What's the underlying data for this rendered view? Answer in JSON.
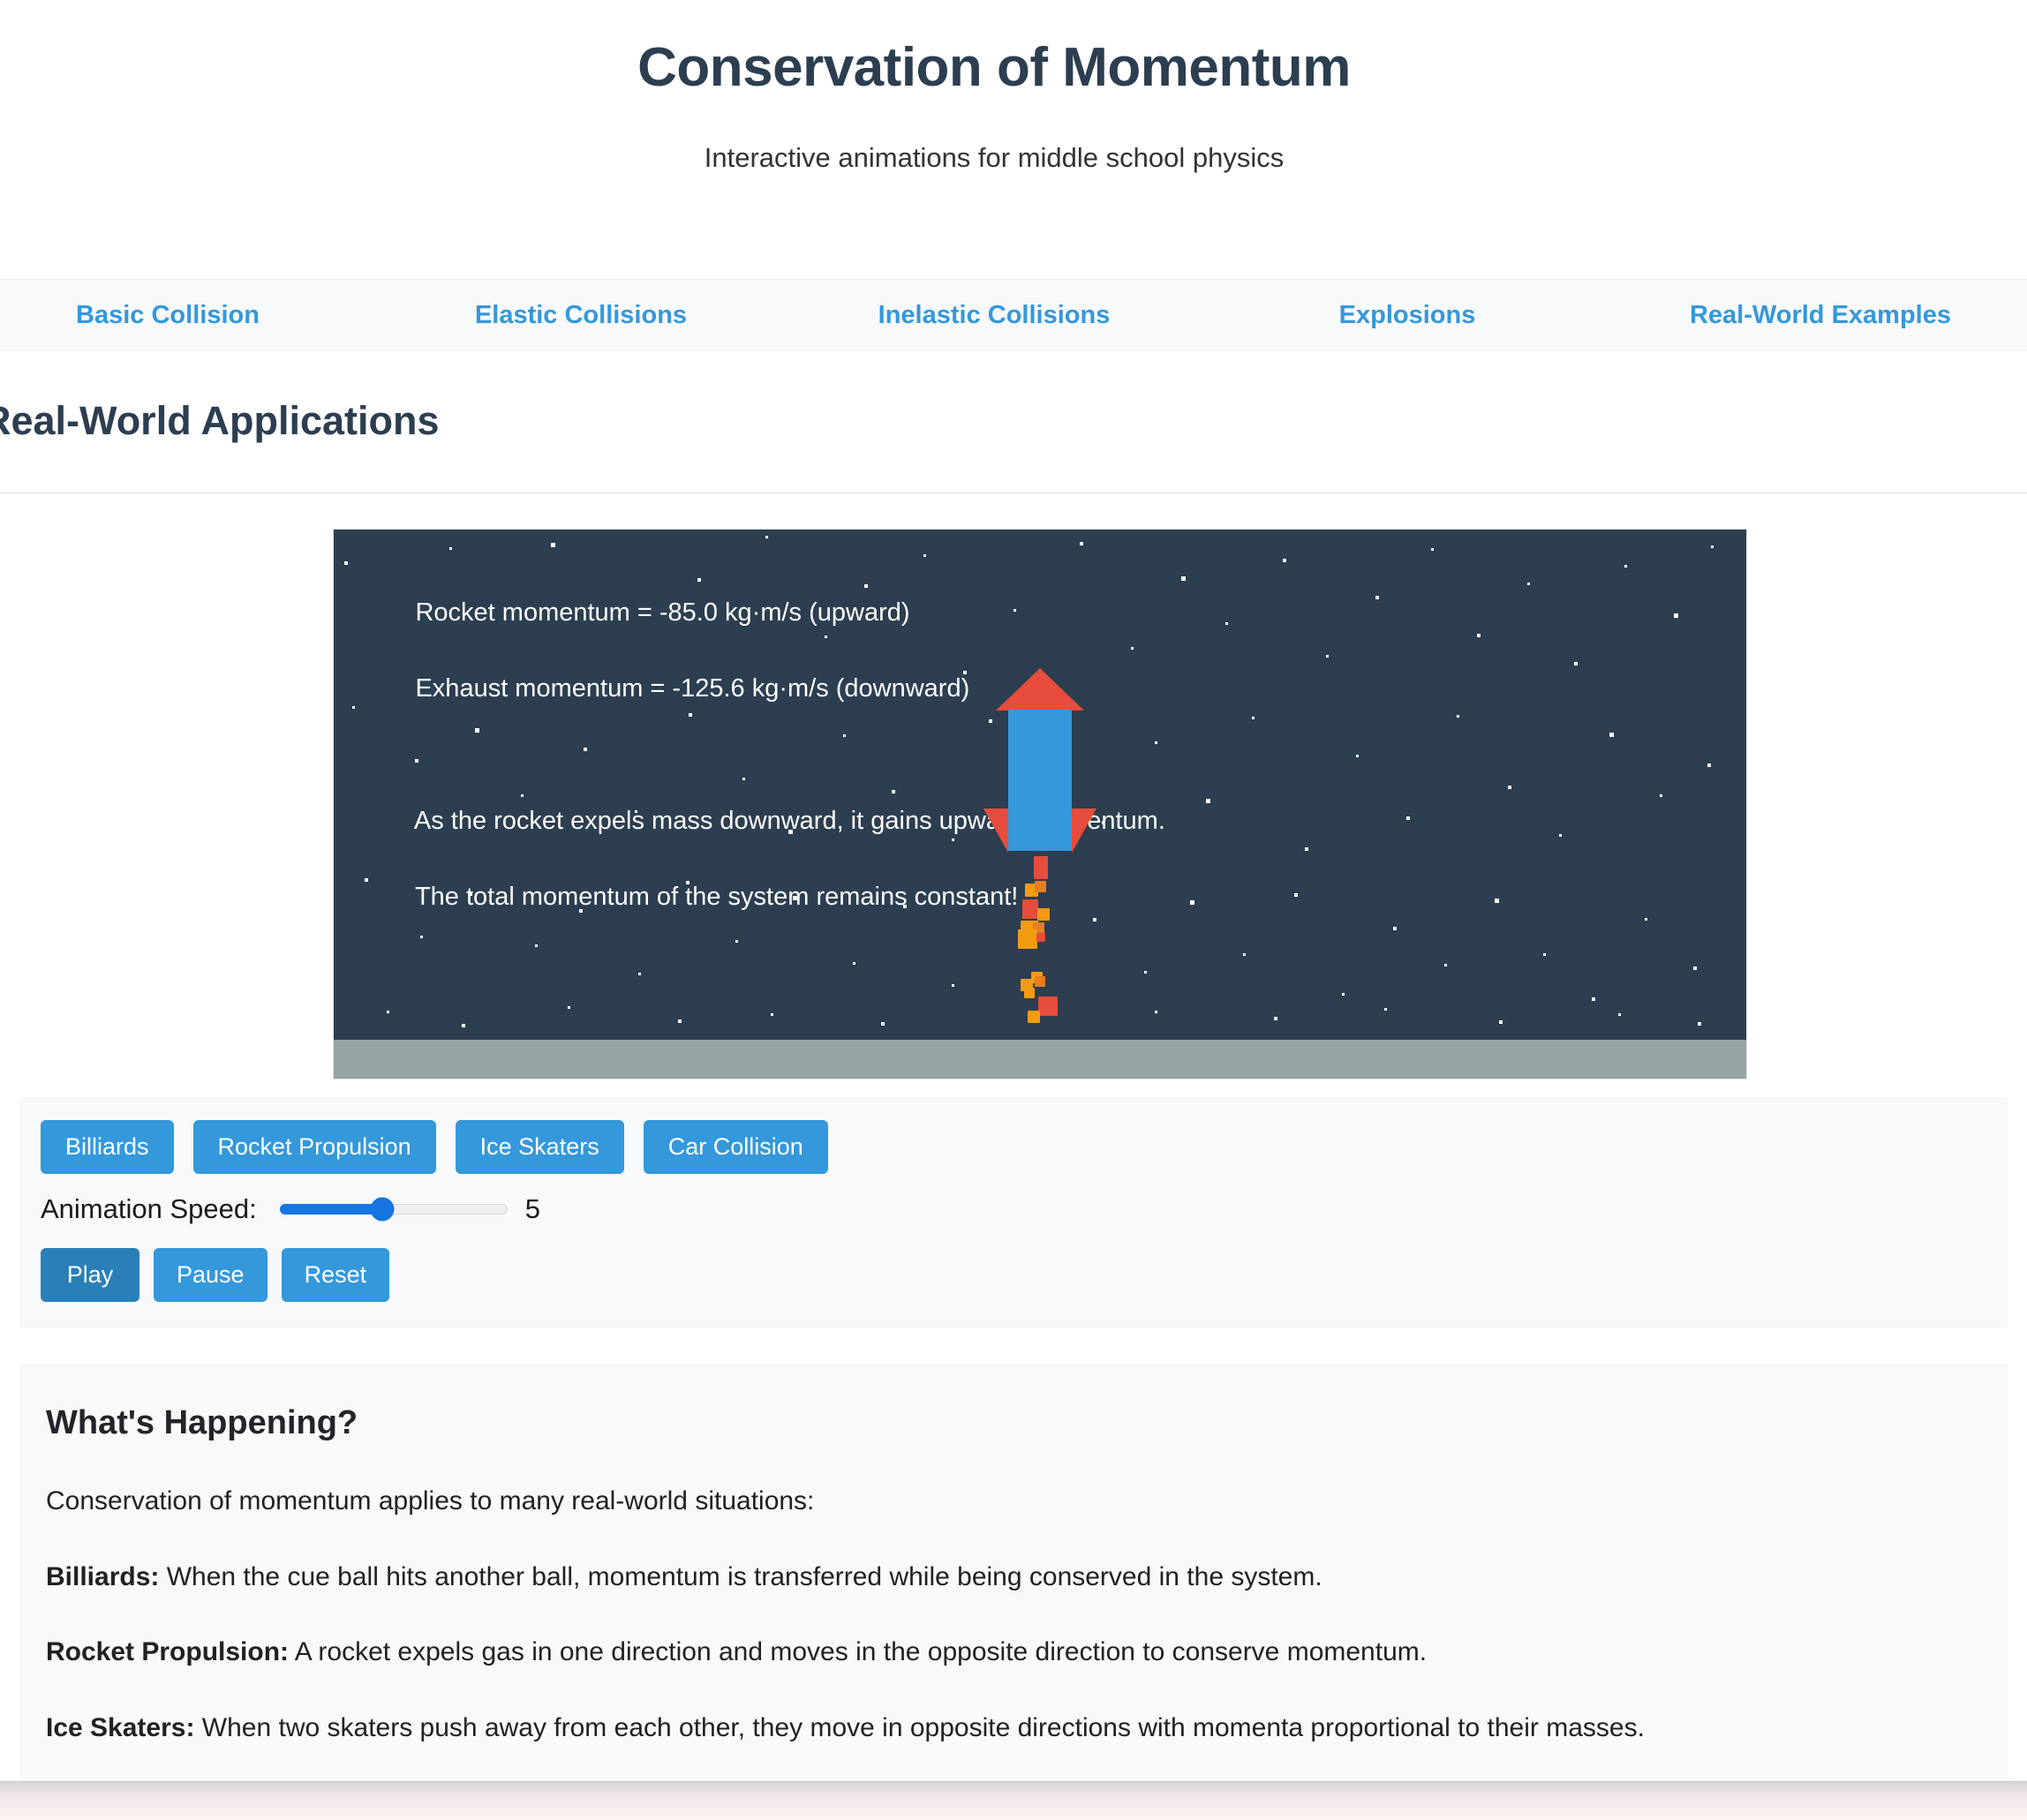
{
  "header": {
    "title": "Conservation of Momentum",
    "subtitle": "Interactive animations for middle school physics"
  },
  "nav": {
    "items": [
      {
        "label": "Basic Collision"
      },
      {
        "label": "Elastic Collisions"
      },
      {
        "label": "Inelastic Collisions"
      },
      {
        "label": "Explosions"
      },
      {
        "label": "Real-World Examples"
      }
    ],
    "active": "Real-World Examples"
  },
  "section": {
    "title": "Real-World Applications"
  },
  "canvas": {
    "readout_line1": "Rocket momentum = -85.0 kg·m/s (upward)",
    "readout_line2": "Exhaust momentum = -125.6 kg·m/s (downward)",
    "readout_line3": "As the rocket expels mass downward, it gains upward momentum.",
    "readout_line4": "The total momentum of the system remains constant!",
    "scene": "rocket-propulsion",
    "sky_color": "#2c3e50",
    "ground_color": "#95a5a6",
    "rocket_body_color": "#3498db",
    "rocket_nose_color": "#e74c3c",
    "flame_colors": [
      "#e74c3c",
      "#f39c12",
      "#e67e22"
    ]
  },
  "controls": {
    "scenarios": [
      {
        "label": "Billiards",
        "active": false
      },
      {
        "label": "Rocket Propulsion",
        "active": false
      },
      {
        "label": "Ice Skaters",
        "active": false
      },
      {
        "label": "Car Collision",
        "active": false
      }
    ],
    "speed_label": "Animation Speed:",
    "speed_value": "5",
    "speed_min": "1",
    "speed_max": "10",
    "playback": [
      {
        "label": "Play",
        "active": true
      },
      {
        "label": "Pause",
        "active": false
      },
      {
        "label": "Reset",
        "active": false
      }
    ],
    "accent_color": "#3498db",
    "accent_active_color": "#2980b9"
  },
  "explanation": {
    "heading": "What's Happening?",
    "intro": "Conservation of momentum applies to many real-world situations:",
    "items": [
      {
        "term": "Billiards:",
        "text": " When the cue ball hits another ball, momentum is transferred while being conserved in the system."
      },
      {
        "term": "Rocket Propulsion:",
        "text": " A rocket expels gas in one direction and moves in the opposite direction to conserve momentum."
      },
      {
        "term": "Ice Skaters:",
        "text": " When two skaters push away from each other, they move in opposite directions with momenta proportional to their masses."
      }
    ]
  },
  "stars": [
    [
      12,
      36,
      4,
      4
    ],
    [
      131,
      20,
      3,
      3
    ],
    [
      246,
      15,
      5,
      5
    ],
    [
      322,
      97,
      3,
      3
    ],
    [
      412,
      55,
      4,
      4
    ],
    [
      489,
      7,
      3,
      3
    ],
    [
      556,
      120,
      3,
      3
    ],
    [
      601,
      62,
      4,
      4
    ],
    [
      668,
      28,
      3,
      3
    ],
    [
      713,
      160,
      4,
      4
    ],
    [
      770,
      90,
      3,
      3
    ],
    [
      845,
      14,
      4,
      4
    ],
    [
      903,
      133,
      3,
      3
    ],
    [
      960,
      53,
      5,
      5
    ],
    [
      1010,
      105,
      3,
      3
    ],
    [
      1075,
      33,
      4,
      4
    ],
    [
      1124,
      142,
      3,
      3
    ],
    [
      1180,
      75,
      4,
      4
    ],
    [
      1243,
      21,
      3,
      3
    ],
    [
      1295,
      118,
      4,
      4
    ],
    [
      1352,
      60,
      3,
      3
    ],
    [
      1405,
      150,
      4,
      4
    ],
    [
      1462,
      40,
      3,
      3
    ],
    [
      1518,
      95,
      5,
      5
    ],
    [
      1560,
      18,
      3,
      3
    ],
    [
      21,
      200,
      3,
      3
    ],
    [
      92,
      260,
      4,
      4
    ],
    [
      160,
      225,
      5,
      5
    ],
    [
      212,
      300,
      3,
      3
    ],
    [
      283,
      247,
      4,
      4
    ],
    [
      341,
      318,
      3,
      3
    ],
    [
      402,
      208,
      4,
      4
    ],
    [
      463,
      281,
      3,
      3
    ],
    [
      515,
      340,
      5,
      5
    ],
    [
      577,
      232,
      3,
      3
    ],
    [
      632,
      295,
      4,
      4
    ],
    [
      700,
      350,
      3,
      3
    ],
    [
      742,
      215,
      4,
      4
    ],
    [
      812,
      272,
      3,
      3
    ],
    [
      870,
      330,
      4,
      4
    ],
    [
      930,
      240,
      3,
      3
    ],
    [
      988,
      305,
      5,
      5
    ],
    [
      1040,
      212,
      3,
      3
    ],
    [
      1100,
      360,
      4,
      4
    ],
    [
      1158,
      255,
      3,
      3
    ],
    [
      1215,
      325,
      4,
      4
    ],
    [
      1272,
      210,
      3,
      3
    ],
    [
      1330,
      290,
      4,
      4
    ],
    [
      1388,
      345,
      3,
      3
    ],
    [
      1445,
      230,
      5,
      5
    ],
    [
      1502,
      300,
      3,
      3
    ],
    [
      1556,
      265,
      4,
      4
    ],
    [
      35,
      395,
      4,
      4
    ],
    [
      98,
      460,
      3,
      3
    ],
    [
      152,
      410,
      5,
      5
    ],
    [
      228,
      470,
      3,
      3
    ],
    [
      278,
      430,
      4,
      4
    ],
    [
      345,
      502,
      3,
      3
    ],
    [
      399,
      398,
      4,
      4
    ],
    [
      455,
      465,
      3,
      3
    ],
    [
      520,
      415,
      5,
      5
    ],
    [
      588,
      490,
      3,
      3
    ],
    [
      645,
      425,
      4,
      4
    ],
    [
      700,
      515,
      3,
      3
    ],
    [
      860,
      440,
      4,
      4
    ],
    [
      918,
      500,
      3,
      3
    ],
    [
      970,
      420,
      5,
      5
    ],
    [
      1030,
      480,
      3,
      3
    ],
    [
      1088,
      412,
      4,
      4
    ],
    [
      1142,
      525,
      3,
      3
    ],
    [
      1200,
      450,
      4,
      4
    ],
    [
      1258,
      492,
      3,
      3
    ],
    [
      1315,
      418,
      5,
      5
    ],
    [
      1370,
      480,
      3,
      3
    ],
    [
      1425,
      530,
      4,
      4
    ],
    [
      1485,
      440,
      3,
      3
    ],
    [
      1540,
      495,
      4,
      4
    ],
    [
      60,
      545,
      3,
      3
    ],
    [
      145,
      560,
      4,
      4
    ],
    [
      265,
      540,
      3,
      3
    ],
    [
      390,
      555,
      4,
      4
    ],
    [
      495,
      548,
      3,
      3
    ],
    [
      620,
      558,
      4,
      4
    ],
    [
      930,
      545,
      3,
      3
    ],
    [
      1065,
      552,
      4,
      4
    ],
    [
      1190,
      542,
      3,
      3
    ],
    [
      1320,
      556,
      4,
      4
    ],
    [
      1455,
      548,
      3,
      3
    ],
    [
      1545,
      558,
      4,
      4
    ]
  ],
  "flames": [
    [
      -7,
      213,
      16,
      26,
      "#e74c3c"
    ],
    [
      -17,
      244,
      15,
      15,
      "#f39c12"
    ],
    [
      -6,
      241,
      13,
      13,
      "#e67e22"
    ],
    [
      -20,
      262,
      18,
      22,
      "#e74c3c"
    ],
    [
      -3,
      272,
      14,
      14,
      "#f39c12"
    ],
    [
      -22,
      286,
      20,
      20,
      "#f39c12"
    ],
    [
      -8,
      288,
      13,
      13,
      "#e67e22"
    ],
    [
      -25,
      296,
      22,
      22,
      "#f39c12"
    ],
    [
      -4,
      300,
      10,
      10,
      "#e74c3c"
    ],
    [
      -10,
      344,
      13,
      13,
      "#f39c12"
    ],
    [
      -22,
      352,
      14,
      14,
      "#f39c12"
    ],
    [
      -6,
      349,
      12,
      12,
      "#e67e22"
    ],
    [
      -18,
      362,
      12,
      12,
      "#f39c12"
    ],
    [
      -2,
      372,
      22,
      22,
      "#e74c3c"
    ],
    [
      -14,
      388,
      14,
      14,
      "#f39c12"
    ]
  ]
}
